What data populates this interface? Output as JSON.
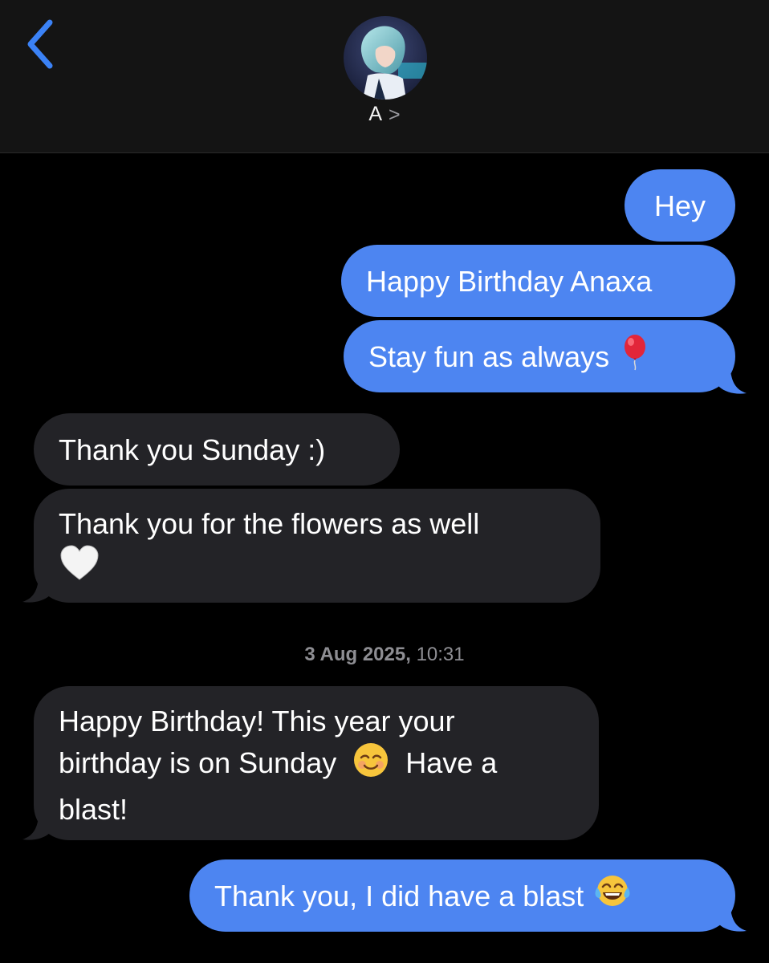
{
  "header": {
    "contact_name": "A",
    "chevron": ">"
  },
  "messages": [
    {
      "side": "sent",
      "text": "Hey"
    },
    {
      "side": "sent",
      "text": "Happy Birthday Anaxa"
    },
    {
      "side": "sent",
      "text": "Stay fun as always",
      "emoji": "balloon-icon"
    },
    {
      "side": "received",
      "text": "Thank you Sunday :)"
    },
    {
      "side": "received",
      "text": "Thank you for the flowers as well",
      "emoji": "white-heart-icon"
    },
    {
      "side": "received",
      "lines": [
        "Happy Birthday! This year your",
        "birthday is on Sunday",
        "Have a",
        "blast!"
      ],
      "emoji": "smiling-face-icon"
    },
    {
      "side": "sent",
      "text": "Thank you, I did have a blast",
      "emoji": "tears-of-joy-icon"
    }
  ],
  "timestamp": {
    "date": "3 Aug 2025,",
    "time": "10:31"
  },
  "colors": {
    "sent_bubble": "#4d85f1",
    "received_bubble": "#232327",
    "accent": "#3b82f6",
    "background": "#000000"
  }
}
